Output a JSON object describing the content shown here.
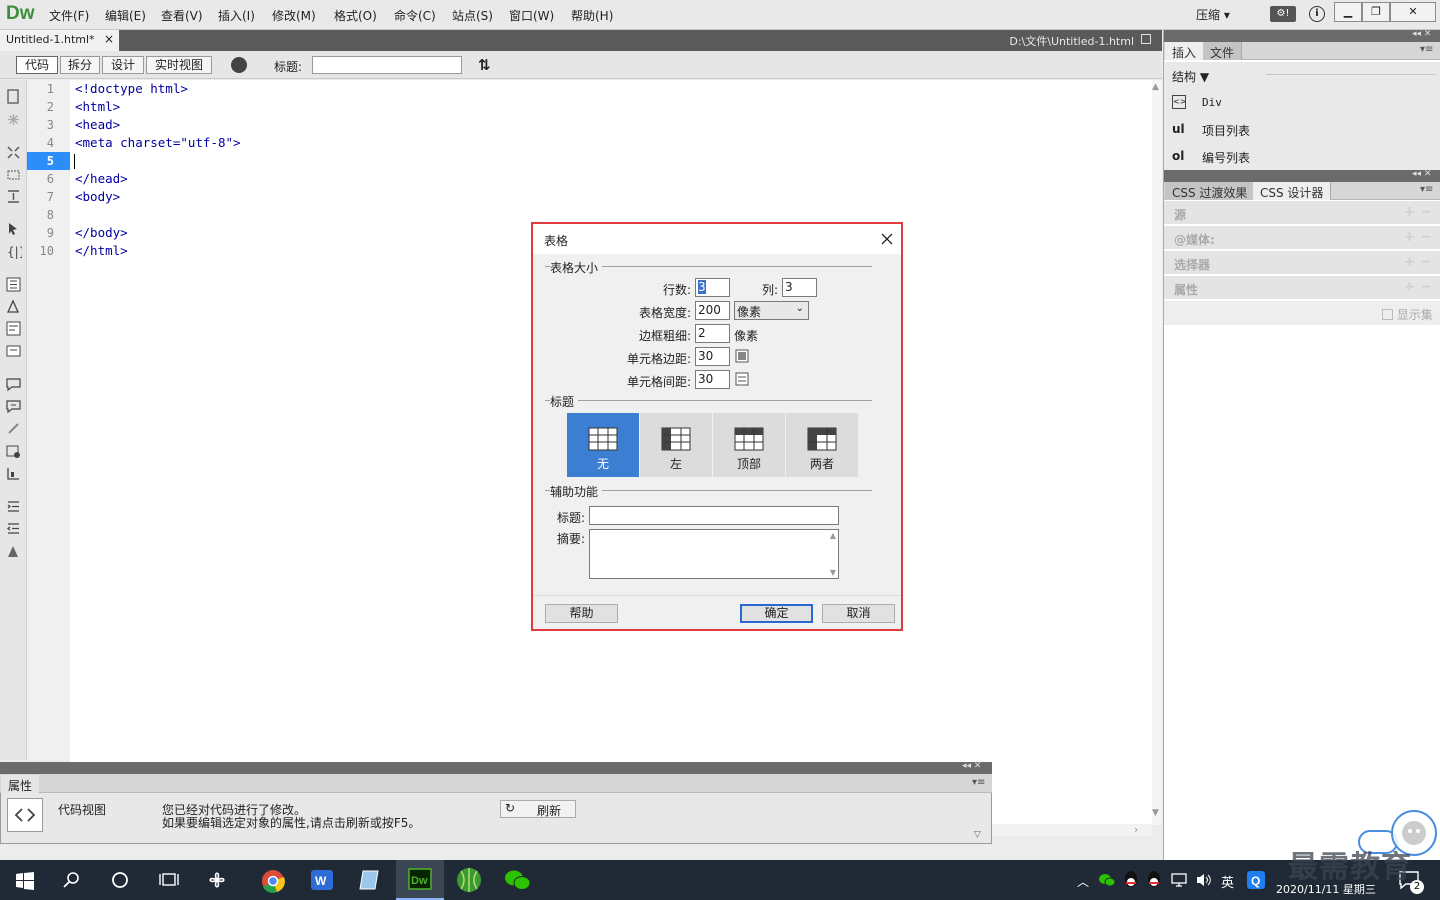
{
  "app": {
    "logo": "Dw",
    "menus": [
      "文件(F)",
      "编辑(E)",
      "查看(V)",
      "插入(I)",
      "修改(M)",
      "格式(O)",
      "命令(C)",
      "站点(S)",
      "窗口(W)",
      "帮助(H)"
    ],
    "workspace_label": "压缩"
  },
  "document": {
    "tab_label": "Untitled-1.html*",
    "path": "D:\\文件\\Untitled-1.html"
  },
  "toolbar": {
    "view_buttons": [
      "代码",
      "拆分",
      "设计",
      "实时视图"
    ],
    "title_label": "标题:"
  },
  "code": {
    "line_numbers": [
      "1",
      "2",
      "3",
      "4",
      "5",
      "6",
      "7",
      "8",
      "9",
      "10"
    ],
    "lines": [
      "<!doctype html>",
      "<html>",
      "<head>",
      "<meta charset=\"utf-8\">",
      "",
      "</head>",
      "<body>",
      "",
      "</body>",
      "</html>"
    ],
    "current_line": "5"
  },
  "properties": {
    "tab": "属性",
    "code_view_label": "代码视图",
    "message_line1": "您已经对代码进行了修改。",
    "message_line2": "如果要编辑选定对象的属性,请点击刷新或按F5。",
    "refresh_label": "刷新"
  },
  "right_panel": {
    "insert_tabs": [
      "插入",
      "文件"
    ],
    "category": "结构",
    "insert_items": [
      {
        "tag": "<>",
        "label": "Div"
      },
      {
        "tag": "ul",
        "label": "项目列表"
      },
      {
        "tag": "ol",
        "label": "编号列表"
      }
    ],
    "css_tabs": [
      "CSS 过渡效果",
      "CSS 设计器"
    ],
    "css_sections": [
      "源",
      "@媒体:",
      "选择器",
      "属性"
    ],
    "show_set": "显示集"
  },
  "dialog": {
    "title": "表格",
    "size_group": "表格大小",
    "rows_label": "行数:",
    "rows_value": "3",
    "cols_label": "列:",
    "cols_value": "3",
    "width_label": "表格宽度:",
    "width_value": "200",
    "width_unit": "像素",
    "border_label": "边框粗细:",
    "border_value": "2",
    "border_unit": "像素",
    "padding_label": "单元格边距:",
    "padding_value": "30",
    "spacing_label": "单元格间距:",
    "spacing_value": "30",
    "header_group": "标题",
    "header_options": [
      "无",
      "左",
      "顶部",
      "两者"
    ],
    "header_selected": "无",
    "access_group": "辅助功能",
    "caption_label": "标题:",
    "summary_label": "摘要:",
    "help_button": "帮助",
    "ok_button": "确定",
    "cancel_button": "取消"
  },
  "taskbar": {
    "tray_lang": "英",
    "date": "2020/11/11 星期三",
    "notification_count": "2"
  },
  "watermark": "最需教育"
}
